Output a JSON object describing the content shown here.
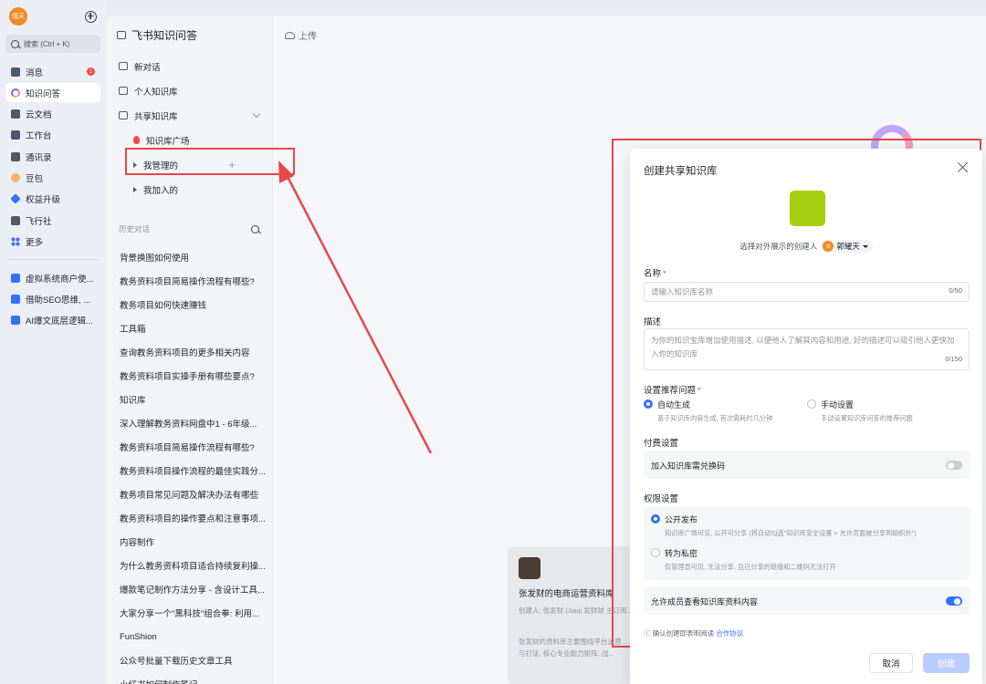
{
  "user": {
    "avatar_text": "晴天"
  },
  "search": {
    "placeholder": "搜索 (Ctrl + K)"
  },
  "rail": {
    "items": [
      {
        "label": "消息",
        "badge": "1"
      },
      {
        "label": "知识问答"
      },
      {
        "label": "云文档"
      },
      {
        "label": "工作台"
      },
      {
        "label": "通讯录"
      },
      {
        "label": "豆包"
      },
      {
        "label": "权益升级"
      },
      {
        "label": "飞行社"
      },
      {
        "label": "更多"
      }
    ],
    "docs": [
      "虚拟系统商户使...",
      "借助SEO思维, ...",
      "AI爆文底层逻辑..."
    ]
  },
  "kb": {
    "title": "飞书知识问答",
    "new_chat": "新对话",
    "personal": "个人知识库",
    "shared": "共享知识库",
    "plaza": "知识库广场",
    "managed": "我管理的",
    "joined": "我加入的",
    "history_label": "历史对话",
    "history": [
      "背景换图如何使用",
      "教务资料项目简易操作流程有哪些?",
      "教务项目如何快速赚钱",
      "工具箱",
      "查询教务资料项目的更多相关内容",
      "教务资料项目实操手册有哪些要点?",
      "知识库",
      "深入理解教务资料网盘中1 - 6年级...",
      "教务资料项目简易操作流程有哪些?",
      "教务资料项目操作流程的最佳实践分...",
      "教务项目常见问题及解决办法有哪些",
      "教务资料项目的操作要点和注意事项...",
      "内容制作",
      "为什么教务资料项目适合持续复利操...",
      "爆款笔记制作方法分享 - 含设计工具...",
      "大家分享一个\"黑科技\"组合拳: 利用...",
      "FunShion",
      "公众号批量下载历史文章工具",
      "小红书如何制作笔记"
    ]
  },
  "toolbar": {
    "upload": "上传"
  },
  "card": {
    "title": "张发财的电商运营资料库",
    "sub": "创建人: 张发财 (Jiaqi 发财财 主订阅...",
    "desc": "张发财的资料库主要围绕平台运营... 与打法, 核心专业能力矩阵, 战..."
  },
  "modal": {
    "title": "创建共享知识库",
    "creator_prefix": "选择对外展示的创建人",
    "creator_name": "郭耀天",
    "creator_avatar": "郭",
    "name_label": "名称",
    "name_placeholder": "请输入知识库名称",
    "name_count": "0/50",
    "desc_label": "描述",
    "desc_placeholder": "为你的知识宝库增加使用描述, 以便他人了解其内容和用途, 好的描述可以吸引他人更快加入你的知识库",
    "desc_count": "0/150",
    "suggest_label": "设置推荐问题",
    "auto_title": "自动生成",
    "auto_desc": "基于知识库内容生成, 首次需耗时几分钟",
    "manual_title": "手动设置",
    "manual_desc": "手动设置知识库问答的推荐问题",
    "paid_label": "付费设置",
    "paid_toggle_label": "加入知识库需兑换码",
    "paid_enabled": false,
    "perm_label": "权限设置",
    "public_title": "公开发布",
    "public_desc": "知识库广场可见, 公开可分享 (将自动勾选\"知识库安全设置 > 允许页面被分享到组织外\")",
    "private_title": "转为私密",
    "private_desc": "仅管理员可见, 无法分享, 且已分享的链接和二维码无法打开",
    "members_label": "允许成员查看知识库资料内容",
    "members_enabled": true,
    "agree_text": "确认创建即表明阅读",
    "agree_link": "合作协议",
    "cancel": "取消",
    "create": "创建"
  },
  "colors": {
    "accent": "#3370ff",
    "highlight": "#e5484d",
    "kb_icon": "#a6cf0f"
  }
}
